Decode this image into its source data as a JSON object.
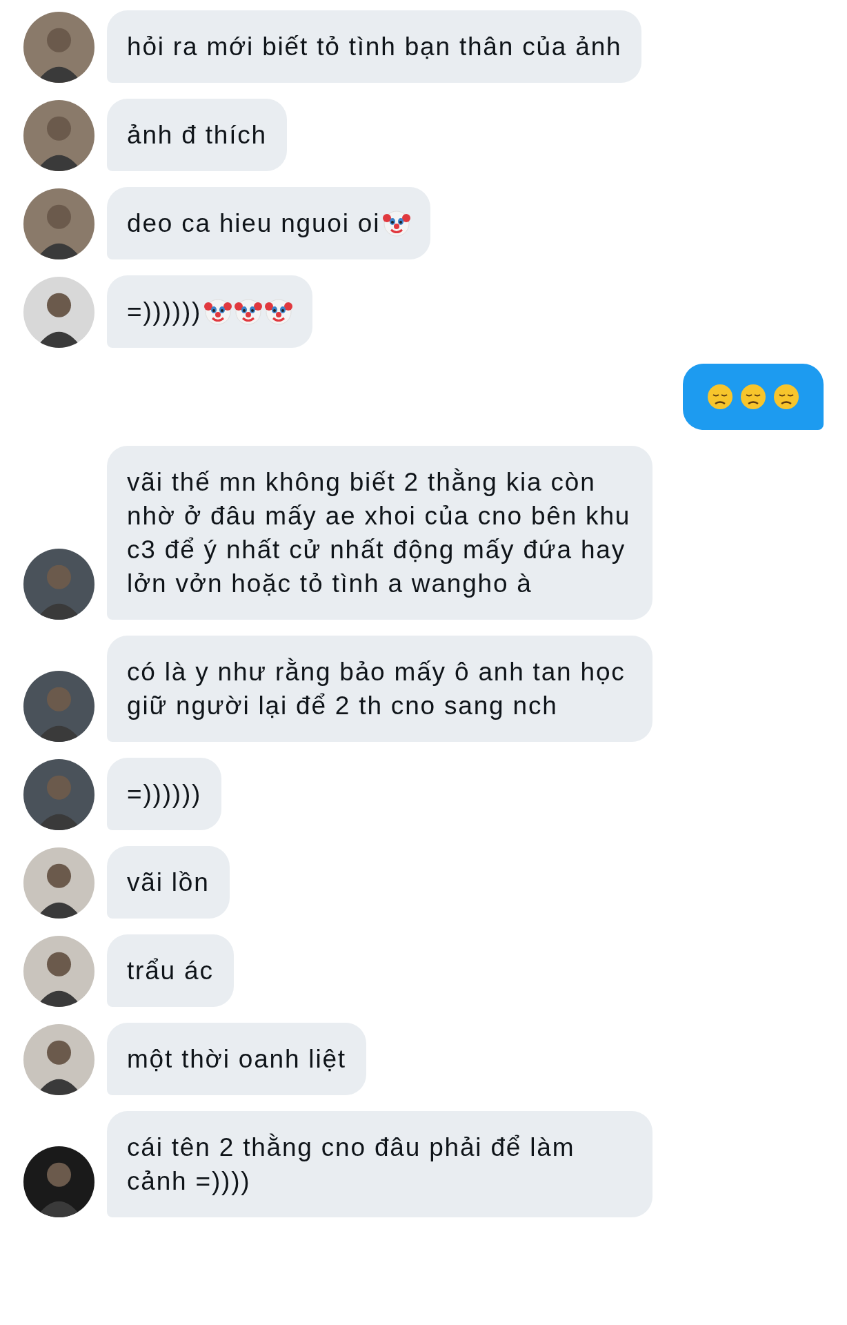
{
  "messages": [
    {
      "kind": "received",
      "color": "#8a7a6a",
      "text": "hỏi ra mới biết tỏ tình bạn thân của ảnh"
    },
    {
      "kind": "received",
      "color": "#8a7a6a",
      "text": "ảnh đ thích"
    },
    {
      "kind": "received",
      "color": "#8a7a6a",
      "text": "deo ca hieu nguoi oi",
      "emojis": [
        {
          "kind": "clown"
        }
      ]
    },
    {
      "kind": "received",
      "color": "#d8d8d8",
      "text": "=))))))",
      "emojis": [
        {
          "kind": "clown"
        },
        {
          "kind": "clown"
        },
        {
          "kind": "clown"
        }
      ]
    },
    {
      "kind": "sent",
      "emojis": [
        {
          "kind": "disappointed"
        },
        {
          "kind": "disappointed"
        },
        {
          "kind": "disappointed"
        }
      ]
    },
    {
      "kind": "received",
      "color": "#4a525a",
      "text": "vãi thế mn không biết 2 thằng kia còn nhờ ở đâu mấy ae xhoi của cno bên khu c3 để ý nhất cử nhất động mấy đứa hay lởn vởn hoặc tỏ tình a wangho à"
    },
    {
      "kind": "received",
      "color": "#4a525a",
      "text": "có là y như rằng bảo mấy ô anh tan học giữ người lại để 2 th cno sang nch"
    },
    {
      "kind": "received",
      "color": "#4a525a",
      "text": "=))))))"
    },
    {
      "kind": "received",
      "color": "#c9c4bd",
      "text": "vãi lồn"
    },
    {
      "kind": "received",
      "color": "#c9c4bd",
      "text": "trẩu ác"
    },
    {
      "kind": "received",
      "color": "#c9c4bd",
      "text": "một thời oanh liệt"
    },
    {
      "kind": "received",
      "color": "#1a1a1a",
      "text": "cái tên 2 thằng cno đâu phải để làm cảnh =))))"
    }
  ]
}
